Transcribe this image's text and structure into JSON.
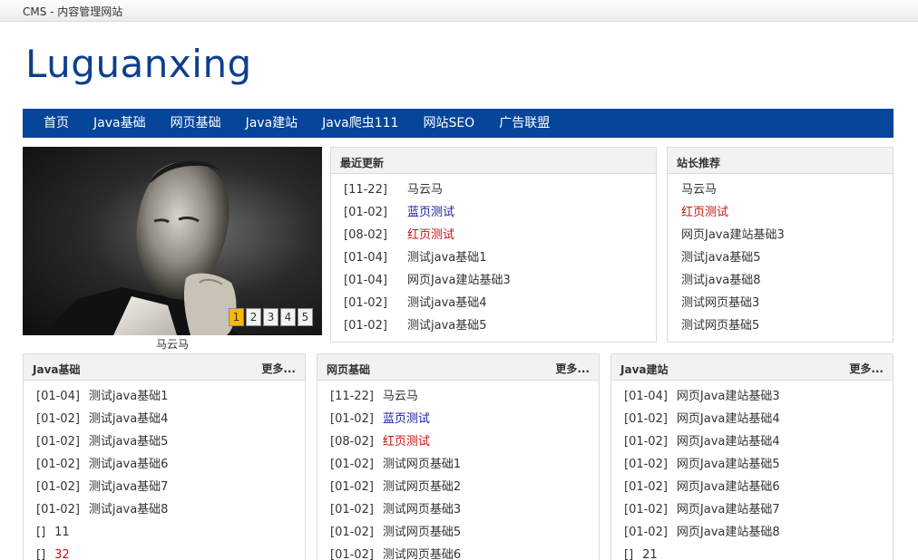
{
  "window": {
    "title": "CMS - 内容管理网站"
  },
  "site": {
    "logo": "Luguanxing"
  },
  "nav": [
    "首页",
    "Java基础",
    "网页基础",
    "Java建站",
    "Java爬虫111",
    "网站SEO",
    "广告联盟"
  ],
  "slider": {
    "caption": "马云马",
    "pages": [
      "1",
      "2",
      "3",
      "4",
      "5"
    ],
    "active_page": 1
  },
  "latest": {
    "title": "最近更新",
    "items": [
      {
        "date": "[11-22]",
        "text": "马云马",
        "color": "default"
      },
      {
        "date": "[01-02]",
        "text": "蓝页测试",
        "color": "blue"
      },
      {
        "date": "[08-02]",
        "text": "红页测试",
        "color": "red"
      },
      {
        "date": "[01-04]",
        "text": "测试java基础1",
        "color": "default"
      },
      {
        "date": "[01-04]",
        "text": "网页Java建站基础3",
        "color": "default"
      },
      {
        "date": "[01-02]",
        "text": "测试java基础4",
        "color": "default"
      },
      {
        "date": "[01-02]",
        "text": "测试java基础5",
        "color": "default"
      }
    ]
  },
  "recommend": {
    "title": "站长推荐",
    "items": [
      {
        "text": "马云马",
        "color": "default"
      },
      {
        "text": "红页测试",
        "color": "red"
      },
      {
        "text": "网页Java建站基础3",
        "color": "default"
      },
      {
        "text": "测试java基础5",
        "color": "default"
      },
      {
        "text": "测试java基础8",
        "color": "default"
      },
      {
        "text": "测试网页基础3",
        "color": "default"
      },
      {
        "text": "测试网页基础5",
        "color": "default"
      }
    ]
  },
  "sections": [
    {
      "title": "Java基础",
      "more": "更多...",
      "items": [
        {
          "date": "[01-04]",
          "text": "测试java基础1",
          "color": "default"
        },
        {
          "date": "[01-02]",
          "text": "测试java基础4",
          "color": "default"
        },
        {
          "date": "[01-02]",
          "text": "测试java基础5",
          "color": "default"
        },
        {
          "date": "[01-02]",
          "text": "测试java基础6",
          "color": "default"
        },
        {
          "date": "[01-02]",
          "text": "测试java基础7",
          "color": "default"
        },
        {
          "date": "[01-02]",
          "text": "测试java基础8",
          "color": "default"
        },
        {
          "date": "[]",
          "text": "11",
          "color": "default"
        },
        {
          "date": "[]",
          "text": "32",
          "color": "red"
        }
      ]
    },
    {
      "title": "网页基础",
      "more": "更多...",
      "items": [
        {
          "date": "[11-22]",
          "text": "马云马",
          "color": "default"
        },
        {
          "date": "[01-02]",
          "text": "蓝页测试",
          "color": "blue"
        },
        {
          "date": "[08-02]",
          "text": "红页测试",
          "color": "red"
        },
        {
          "date": "[01-02]",
          "text": "测试网页基础1",
          "color": "default"
        },
        {
          "date": "[01-02]",
          "text": "测试网页基础2",
          "color": "default"
        },
        {
          "date": "[01-02]",
          "text": "测试网页基础3",
          "color": "default"
        },
        {
          "date": "[01-02]",
          "text": "测试网页基础5",
          "color": "default"
        },
        {
          "date": "[01-02]",
          "text": "测试网页基础6",
          "color": "default"
        }
      ]
    },
    {
      "title": "Java建站",
      "more": "更多...",
      "items": [
        {
          "date": "[01-04]",
          "text": "网页Java建站基础3",
          "color": "default"
        },
        {
          "date": "[01-02]",
          "text": "网页Java建站基础4",
          "color": "default"
        },
        {
          "date": "[01-02]",
          "text": "网页Java建站基础4",
          "color": "default"
        },
        {
          "date": "[01-02]",
          "text": "网页Java建站基础5",
          "color": "default"
        },
        {
          "date": "[01-02]",
          "text": "网页Java建站基础6",
          "color": "default"
        },
        {
          "date": "[01-02]",
          "text": "网页Java建站基础7",
          "color": "default"
        },
        {
          "date": "[01-02]",
          "text": "网页Java建站基础8",
          "color": "default"
        },
        {
          "date": "[]",
          "text": "21",
          "color": "default"
        }
      ]
    }
  ]
}
